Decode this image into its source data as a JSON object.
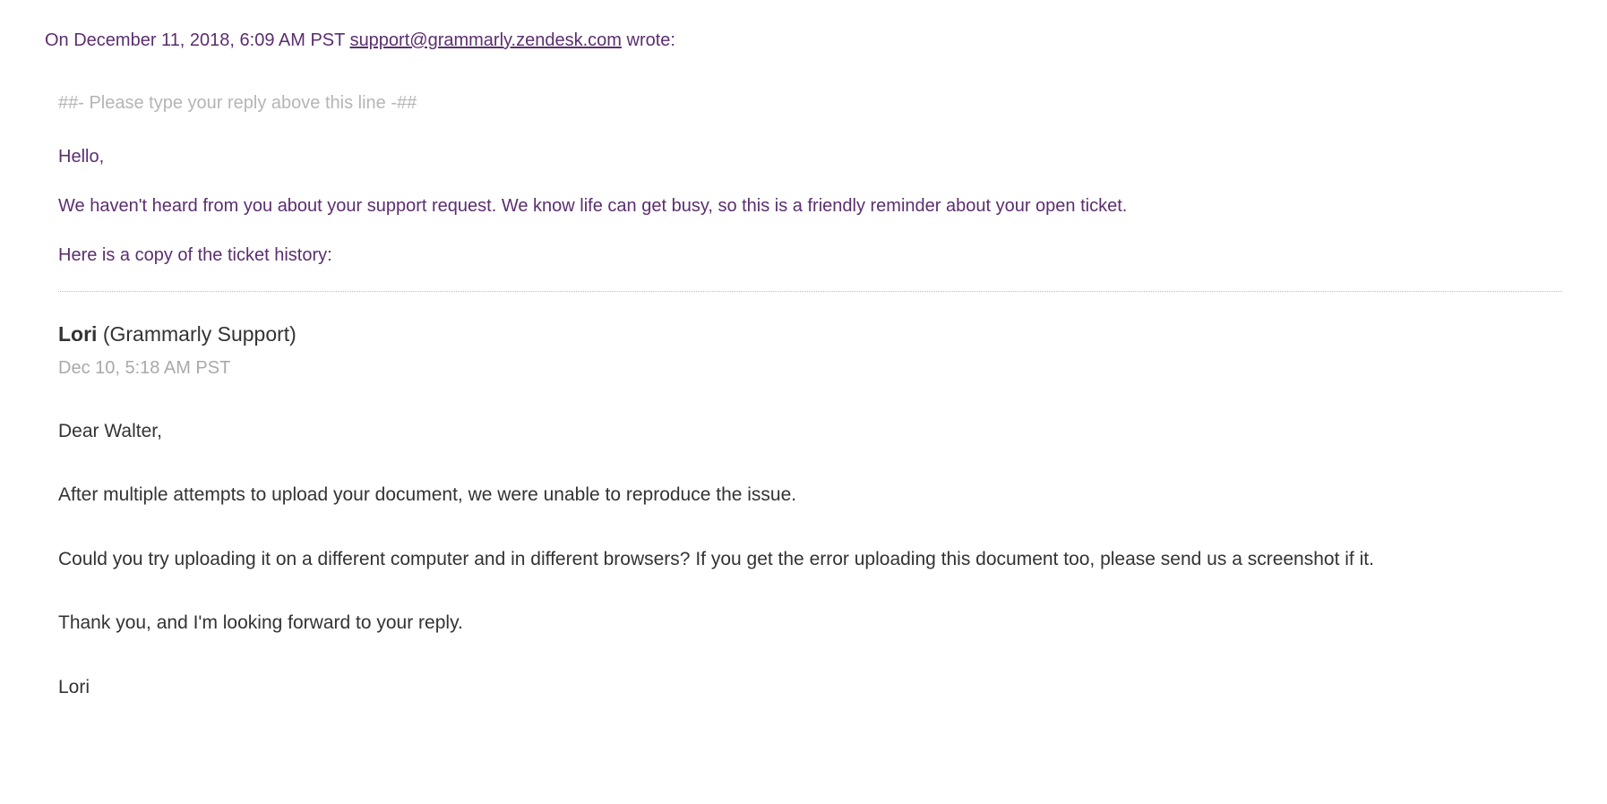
{
  "header": {
    "prefix": "On December 11, 2018, 6:09 AM PST ",
    "email": "support@grammarly.zendesk.com",
    "suffix": " wrote:"
  },
  "reply_marker": "##- Please type your reply above this line -##",
  "intro": {
    "greeting": "Hello,",
    "line1": "We haven't heard from you about your support request. We know life can get busy, so this is a friendly reminder about your open ticket.",
    "line2": "Here is a copy of the ticket history:"
  },
  "entry": {
    "agent_name": "Lori",
    "agent_org": " (Grammarly Support)",
    "timestamp": "Dec 10, 5:18 AM PST",
    "body": {
      "greeting": "Dear Walter,",
      "p1": "After multiple attempts to upload your document, we were unable to reproduce the issue.",
      "p2": "Could you try uploading it on a different computer and in different browsers? If you get the error uploading this document too, please send us a screenshot if it.",
      "p3": "Thank you, and I'm looking forward to your reply.",
      "signature": "Lori"
    }
  }
}
